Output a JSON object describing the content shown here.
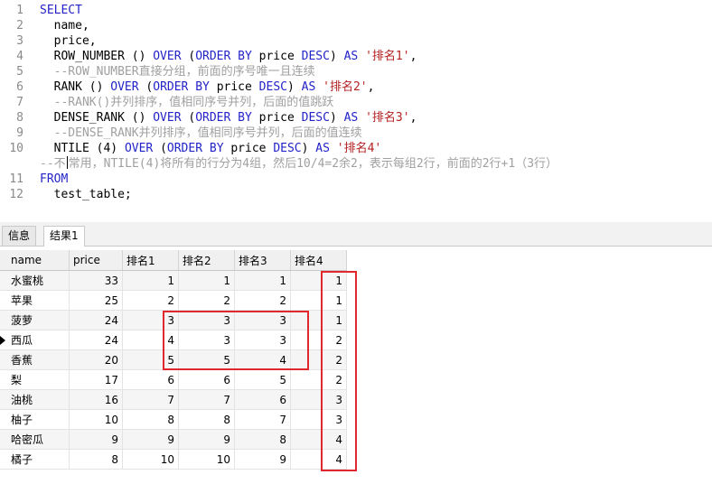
{
  "editor": {
    "lines": [
      {
        "num": "1",
        "tokens": [
          {
            "t": "SELECT",
            "c": "kw"
          }
        ]
      },
      {
        "num": "2",
        "tokens": [
          {
            "t": "  name,",
            "c": ""
          }
        ]
      },
      {
        "num": "3",
        "tokens": [
          {
            "t": "  price,",
            "c": ""
          }
        ]
      },
      {
        "num": "4",
        "tokens": [
          {
            "t": "  ROW_NUMBER () ",
            "c": ""
          },
          {
            "t": "OVER",
            "c": "kw"
          },
          {
            "t": " (",
            "c": ""
          },
          {
            "t": "ORDER BY",
            "c": "kw"
          },
          {
            "t": " price ",
            "c": ""
          },
          {
            "t": "DESC",
            "c": "kw"
          },
          {
            "t": ") ",
            "c": ""
          },
          {
            "t": "AS",
            "c": "kw"
          },
          {
            "t": " ",
            "c": ""
          },
          {
            "t": "'排名1'",
            "c": "str"
          },
          {
            "t": ",",
            "c": ""
          }
        ]
      },
      {
        "num": "5",
        "tokens": [
          {
            "t": "  --ROW_NUMBER直接分组，前面的序号唯一且连续",
            "c": "cm"
          }
        ]
      },
      {
        "num": "6",
        "tokens": [
          {
            "t": "  RANK () ",
            "c": ""
          },
          {
            "t": "OVER",
            "c": "kw"
          },
          {
            "t": " (",
            "c": ""
          },
          {
            "t": "ORDER BY",
            "c": "kw"
          },
          {
            "t": " price ",
            "c": ""
          },
          {
            "t": "DESC",
            "c": "kw"
          },
          {
            "t": ") ",
            "c": ""
          },
          {
            "t": "AS",
            "c": "kw"
          },
          {
            "t": " ",
            "c": ""
          },
          {
            "t": "'排名2'",
            "c": "str"
          },
          {
            "t": ",",
            "c": ""
          }
        ]
      },
      {
        "num": "7",
        "tokens": [
          {
            "t": "  --RANK()并列排序，值相同序号并列，后面的值跳跃",
            "c": "cm"
          }
        ]
      },
      {
        "num": "8",
        "tokens": [
          {
            "t": "  DENSE_RANK () ",
            "c": ""
          },
          {
            "t": "OVER",
            "c": "kw"
          },
          {
            "t": " (",
            "c": ""
          },
          {
            "t": "ORDER BY",
            "c": "kw"
          },
          {
            "t": " price ",
            "c": ""
          },
          {
            "t": "DESC",
            "c": "kw"
          },
          {
            "t": ") ",
            "c": ""
          },
          {
            "t": "AS",
            "c": "kw"
          },
          {
            "t": " ",
            "c": ""
          },
          {
            "t": "'排名3'",
            "c": "str"
          },
          {
            "t": ",",
            "c": ""
          }
        ]
      },
      {
        "num": "9",
        "tokens": [
          {
            "t": "  --DENSE_RANK并列排序，值相同序号并列，后面的值连续",
            "c": "cm"
          }
        ]
      },
      {
        "num": "10",
        "tokens": [
          {
            "t": "  NTILE (",
            "c": ""
          },
          {
            "t": "4",
            "c": ""
          },
          {
            "t": ") ",
            "c": ""
          },
          {
            "t": "OVER",
            "c": "kw"
          },
          {
            "t": " (",
            "c": ""
          },
          {
            "t": "ORDER BY",
            "c": "kw"
          },
          {
            "t": " price ",
            "c": ""
          },
          {
            "t": "DESC",
            "c": "kw"
          },
          {
            "t": ") ",
            "c": ""
          },
          {
            "t": "AS",
            "c": "kw"
          },
          {
            "t": " ",
            "c": ""
          },
          {
            "t": "'排名4'",
            "c": "str"
          }
        ]
      },
      {
        "num": "",
        "tokens": [
          {
            "t": "--不",
            "c": "cm"
          },
          {
            "t": "",
            "c": "caret"
          },
          {
            "t": "常用，NTILE(4)将所有的行分为4组，然后10/4=2余2，表示每组2行，前面的2行+1（3行）",
            "c": "cm"
          }
        ]
      },
      {
        "num": "11",
        "tokens": [
          {
            "t": "FROM",
            "c": "kw"
          }
        ]
      },
      {
        "num": "12",
        "tokens": [
          {
            "t": "  test_table;",
            "c": ""
          }
        ]
      }
    ]
  },
  "tabs": [
    {
      "label": "信息",
      "active": false
    },
    {
      "label": "结果1",
      "active": true
    }
  ],
  "grid": {
    "columns": [
      "name",
      "price",
      "排名1",
      "排名2",
      "排名3",
      "排名4"
    ],
    "rows": [
      [
        "水蜜桃",
        "33",
        "1",
        "1",
        "1",
        "1"
      ],
      [
        "苹果",
        "25",
        "2",
        "2",
        "2",
        "1"
      ],
      [
        "菠萝",
        "24",
        "3",
        "3",
        "3",
        "1"
      ],
      [
        "西瓜",
        "24",
        "4",
        "3",
        "3",
        "2"
      ],
      [
        "香蕉",
        "20",
        "5",
        "5",
        "4",
        "2"
      ],
      [
        "梨",
        "17",
        "6",
        "6",
        "5",
        "2"
      ],
      [
        "油桃",
        "16",
        "7",
        "7",
        "6",
        "3"
      ],
      [
        "柚子",
        "10",
        "8",
        "8",
        "7",
        "3"
      ],
      [
        "哈密瓜",
        "9",
        "9",
        "9",
        "8",
        "4"
      ],
      [
        "橘子",
        "8",
        "10",
        "10",
        "9",
        "4"
      ]
    ],
    "current_row": 3
  },
  "colors": {
    "keyword": "#2323c8",
    "string": "#b52020",
    "comment": "#a0a0a0",
    "highlight": "#e0282d"
  }
}
